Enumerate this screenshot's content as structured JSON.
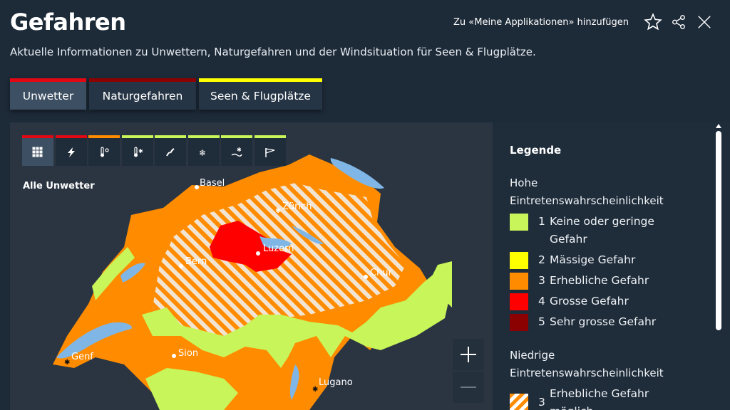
{
  "header": {
    "title": "Gefahren",
    "subtitle": "Aktuelle Informationen zu Unwettern, Naturgefahren und der Windsituation für Seen & Flugplätze.",
    "add_link": "Zu «Meine Applikationen» hinzufügen",
    "icons": [
      "star-icon",
      "share-icon",
      "close-icon"
    ]
  },
  "tabs": [
    {
      "label": "Unwetter",
      "color": "#e30613",
      "active": true
    },
    {
      "label": "Naturgefahren",
      "color": "#8b0000",
      "active": false
    },
    {
      "label": "Seen & Flugplätze",
      "color": "#ffff00",
      "active": false
    }
  ],
  "filters": [
    {
      "icon": "grid-icon",
      "color": "#e30613",
      "active": true
    },
    {
      "icon": "lightning-icon",
      "color": "#e30613"
    },
    {
      "icon": "heat-icon",
      "color": "#ff8c00"
    },
    {
      "icon": "cold-icon",
      "color": "#c8f55a"
    },
    {
      "icon": "rain-icon",
      "color": "#c8f55a"
    },
    {
      "icon": "snow-icon",
      "color": "#c8f55a"
    },
    {
      "icon": "ice-icon",
      "color": "#c8f55a"
    },
    {
      "icon": "wind-icon",
      "color": "#c8f55a"
    }
  ],
  "map": {
    "label": "Alle Unwetter",
    "cities": [
      "Basel",
      "Zürich",
      "Luzern",
      "Bern",
      "Chur",
      "Genf",
      "Sion",
      "Lugano"
    ]
  },
  "legend": {
    "title": "Legende",
    "high_prob": "Hohe Eintretenswahrscheinlichkeit",
    "levels": [
      {
        "level": "1",
        "label": "Keine oder geringe Gefahr",
        "color": "#c8f55a"
      },
      {
        "level": "2",
        "label": "Mässige Gefahr",
        "color": "#ffff00"
      },
      {
        "level": "3",
        "label": "Erhebliche Gefahr",
        "color": "#ff8c00"
      },
      {
        "level": "4",
        "label": "Grosse Gefahr",
        "color": "#ff0000"
      },
      {
        "level": "5",
        "label": "Sehr grosse Gefahr",
        "color": "#8b0000"
      }
    ],
    "low_prob": "Niedrige Eintretenswahrscheinlichkeit",
    "low_levels": [
      {
        "level": "3",
        "label": "Erhebliche Gefahr möglich",
        "color": "#ff8c00"
      }
    ]
  }
}
